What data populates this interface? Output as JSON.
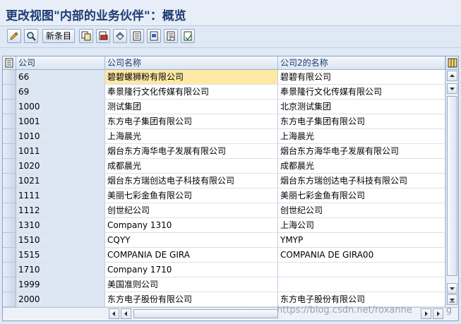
{
  "window": {
    "title": "更改视图\"内部的业务伙伴\"：概览"
  },
  "toolbar": {
    "buttons": [
      {
        "icon": "edit-pencil-icon"
      },
      {
        "icon": "display-glasses-icon"
      },
      {
        "label": "新条目"
      },
      {
        "icon": "copy-icon"
      },
      {
        "icon": "delete-icon"
      },
      {
        "icon": "undo-icon"
      },
      {
        "icon": "select-all-icon"
      },
      {
        "icon": "select-block-icon"
      },
      {
        "icon": "deselect-all-icon"
      },
      {
        "icon": "print-icon"
      }
    ]
  },
  "table": {
    "columns": [
      "公司",
      "公司名称",
      "公司2的名称"
    ],
    "rows": [
      {
        "code": "66",
        "name": "碧碧螺狮粉有限公司",
        "name2": "碧碧有限公司",
        "highlight": true
      },
      {
        "code": "69",
        "name": "奉景隆行文化传媒有限公司",
        "name2": "奉景隆行文化传媒有限公司"
      },
      {
        "code": "1000",
        "name": "测试集团",
        "name2": "北京测试集团"
      },
      {
        "code": "1001",
        "name": "东方电子集团有限公司",
        "name2": "东方电子集团有限公司"
      },
      {
        "code": "1010",
        "name": "上海晨光",
        "name2": "上海晨光"
      },
      {
        "code": "1011",
        "name": "烟台东方海华电子发展有限公司",
        "name2": "烟台东方海华电子发展有限公司"
      },
      {
        "code": "1020",
        "name": "成都晨光",
        "name2": "成都晨光"
      },
      {
        "code": "1021",
        "name": "烟台东方瑞创达电子科技有限公司",
        "name2": "烟台东方瑞创达电子科技有限公司"
      },
      {
        "code": "1111",
        "name": "美丽七彩金鱼有限公司",
        "name2": "美丽七彩金鱼有限公司"
      },
      {
        "code": "1112",
        "name": "创世纪公司",
        "name2": "创世纪公司"
      },
      {
        "code": "1310",
        "name": "Company 1310",
        "name2": "上海公司"
      },
      {
        "code": "1510",
        "name": "CQYY",
        "name2": "YMYP"
      },
      {
        "code": "1515",
        "name": "COMPANIA DE GIRA",
        "name2": "COMPANIA DE GIRA00"
      },
      {
        "code": "1710",
        "name": "Company 1710",
        "name2": ""
      },
      {
        "code": "1999",
        "name": "美国准则公司",
        "name2": ""
      },
      {
        "code": "2000",
        "name": "东方电子股份有限公司",
        "name2": "东方电子股份有限公司"
      }
    ]
  },
  "watermark": "https://blog.csdn.net/roxanne",
  "watermark_tail": "g",
  "colors": {
    "title": "#1f3c73",
    "highlight": "#fde9a5",
    "key_column": "#dde7f3"
  }
}
